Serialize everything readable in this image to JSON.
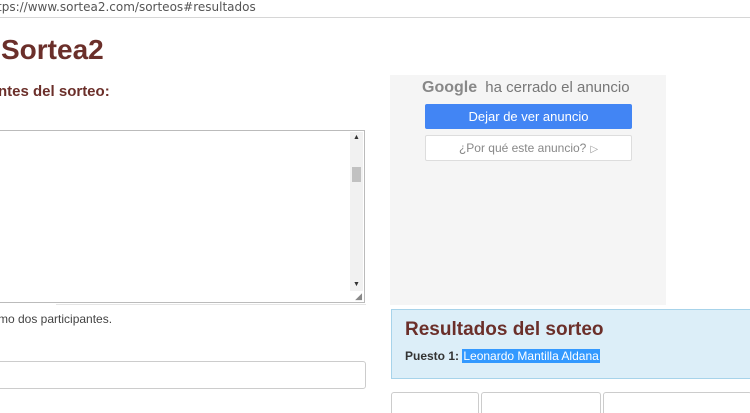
{
  "browser": {
    "url": "tps://www.sortea2.com/sorteos#resultados"
  },
  "header": {
    "title": "Sortea2"
  },
  "form": {
    "section_label": "ntes del sorteo:",
    "textarea_value": "",
    "hint": "mo dos participantes.",
    "input_value": ""
  },
  "ad": {
    "google_label": "Google",
    "closed_text": "ha cerrado el anuncio",
    "stop_button": "Dejar de ver anuncio",
    "why_button": "¿Por qué este anuncio?",
    "why_icon": "▷"
  },
  "results": {
    "title": "Resultados del sorteo",
    "place_label": "Puesto 1:",
    "winner": "Leonardo Mantilla Aldana"
  },
  "scrollbar": {
    "up_glyph": "▲",
    "down_glyph": "▼",
    "grip_glyph": "◢"
  }
}
